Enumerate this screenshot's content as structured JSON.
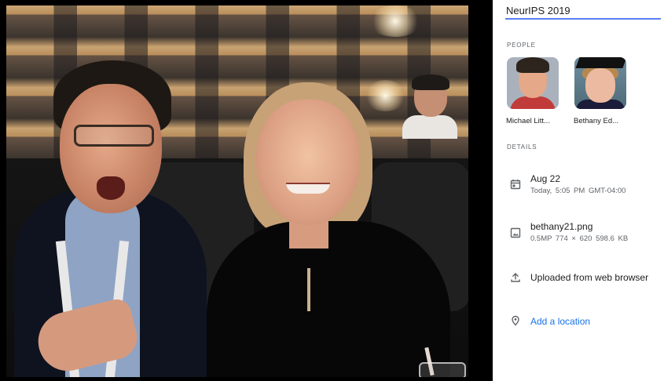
{
  "photo": {
    "description_icon": "photo"
  },
  "info": {
    "title_value": "NeurIPS 2019",
    "people_label": "PEOPLE",
    "people": [
      {
        "name": "Michael Litt..."
      },
      {
        "name": "Bethany Ed..."
      }
    ],
    "details_label": "DETAILS",
    "date": {
      "icon": "calendar-icon",
      "primary": "Aug 22",
      "secondary": "Today, 5:05 PM   GMT-04:00"
    },
    "file": {
      "icon": "image-icon",
      "primary": "bethany21.png",
      "secondary": "0.5MP   774 × 620   598.6 KB"
    },
    "upload": {
      "icon": "upload-icon",
      "primary": "Uploaded from web browser"
    },
    "location": {
      "icon": "location-pin-icon",
      "primary": "Add a location"
    }
  },
  "colors": {
    "accent": "#1a73e8",
    "input_underline": "#5b7ff3"
  }
}
